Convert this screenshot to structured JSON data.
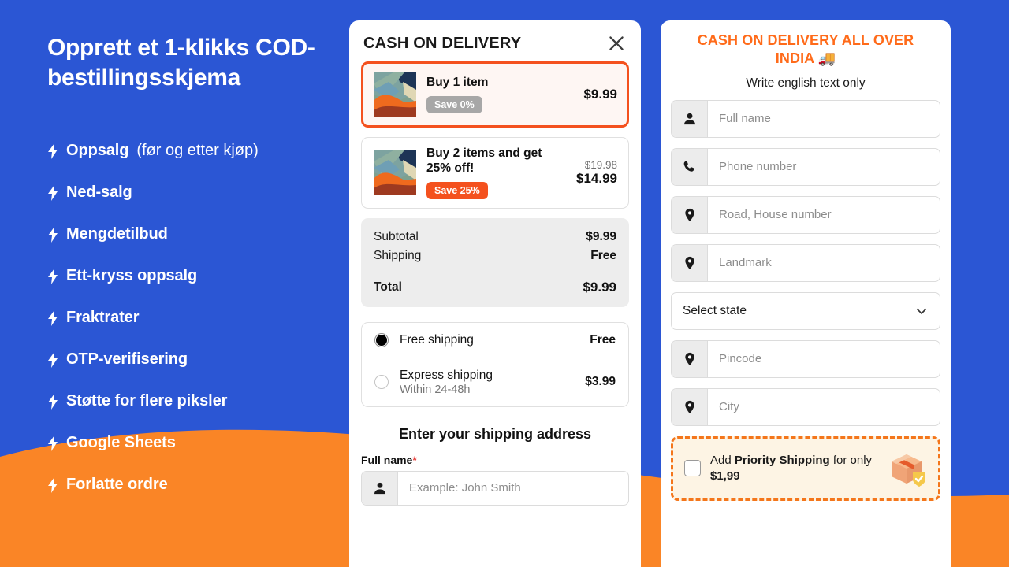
{
  "theme": {
    "background_blue": "#2B56D4",
    "wave_orange": "#FA8526",
    "accent_orange": "#F4511E",
    "title_orange": "#FF6B1A"
  },
  "promo": {
    "title": "Opprett et 1-klikks COD-bestillingsskjema",
    "features": [
      {
        "icon": "bolt-icon",
        "label": "Oppsalg",
        "suffix": " (før og etter kjøp)"
      },
      {
        "icon": "bolt-icon",
        "label": "Ned-salg",
        "suffix": ""
      },
      {
        "icon": "bolt-icon",
        "label": "Mengdetilbud",
        "suffix": ""
      },
      {
        "icon": "bolt-icon",
        "label": "Ett-kryss oppsalg",
        "suffix": ""
      },
      {
        "icon": "bolt-icon",
        "label": "Fraktrater",
        "suffix": ""
      },
      {
        "icon": "bolt-icon",
        "label": "OTP-verifisering",
        "suffix": ""
      },
      {
        "icon": "bolt-icon",
        "label": "Støtte for flere piksler",
        "suffix": ""
      },
      {
        "icon": "bolt-icon",
        "label": "Google Sheets",
        "suffix": ""
      },
      {
        "icon": "bolt-icon",
        "label": "Forlatte ordre",
        "suffix": ""
      }
    ]
  },
  "center_panel": {
    "title": "CASH ON DELIVERY",
    "close_icon": "close-icon",
    "offers": [
      {
        "headline": "Buy 1 item",
        "badge": "Save 0%",
        "badge_style": "gray",
        "price": "$9.99",
        "compare_at": "",
        "selected": true,
        "image": "pillow-thumbnail"
      },
      {
        "headline": "Buy 2 items and get 25% off!",
        "badge": "Save 25%",
        "badge_style": "orange",
        "price": "$14.99",
        "compare_at": "$19.98",
        "selected": false,
        "image": "pillow-thumbnail"
      }
    ],
    "summary": {
      "subtotal_label": "Subtotal",
      "subtotal_value": "$9.99",
      "shipping_label": "Shipping",
      "shipping_value": "Free",
      "total_label": "Total",
      "total_value": "$9.99"
    },
    "shipping_options": [
      {
        "name": "Free shipping",
        "sub": "",
        "price": "Free",
        "selected": true
      },
      {
        "name": "Express shipping",
        "sub": "Within 24-48h",
        "price": "$3.99",
        "selected": false
      }
    ],
    "address_heading": "Enter your shipping address",
    "full_name_label": "Full name",
    "required_mark": "*",
    "full_name_placeholder": "Example: John Smith",
    "full_name_icon": "person-icon"
  },
  "right_panel": {
    "title": "CASH ON DELIVERY ALL OVER INDIA 🚚",
    "subtitle": "Write english text only",
    "fields": [
      {
        "icon": "person-icon",
        "placeholder": "Full name"
      },
      {
        "icon": "phone-icon",
        "placeholder": "Phone number"
      },
      {
        "icon": "location-icon",
        "placeholder": "Road, House number"
      },
      {
        "icon": "location-icon",
        "placeholder": "Landmark"
      }
    ],
    "state_select": {
      "value": "Select state",
      "chevron_icon": "chevron-down-icon"
    },
    "fields_after": [
      {
        "icon": "location-icon",
        "placeholder": "Pincode"
      },
      {
        "icon": "location-icon",
        "placeholder": "City"
      }
    ],
    "priority": {
      "prefix": "Add ",
      "bold": "Priority Shipping",
      "middle": " for only ",
      "price": "$1,99",
      "checkbox_icon": "checkbox-unchecked",
      "image": "package-shield-icon"
    }
  }
}
